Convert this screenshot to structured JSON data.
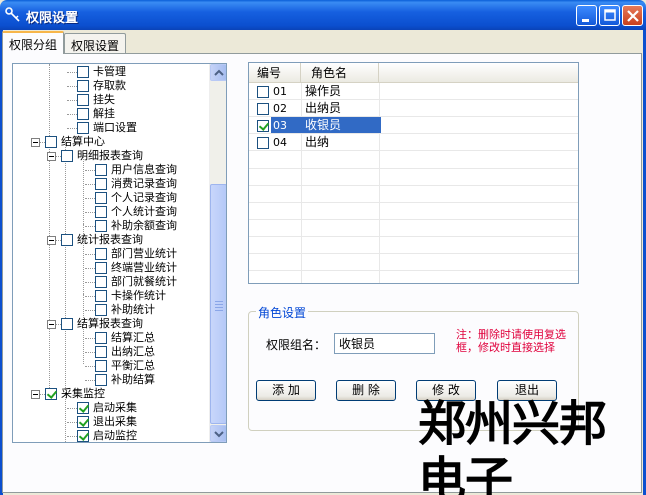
{
  "window": {
    "title": "权限设置",
    "icon": "key-icon"
  },
  "tabs": [
    {
      "label": "权限分组",
      "active": true
    },
    {
      "label": "权限设置",
      "active": false
    }
  ],
  "tree": {
    "items": [
      {
        "label": "卡管理",
        "level": 3,
        "checked": false,
        "expander": false
      },
      {
        "label": "存取款",
        "level": 3,
        "checked": false,
        "expander": false
      },
      {
        "label": "挂失",
        "level": 3,
        "checked": false,
        "expander": false
      },
      {
        "label": "解挂",
        "level": 3,
        "checked": false,
        "expander": false
      },
      {
        "label": "端口设置",
        "level": 3,
        "checked": false,
        "expander": false
      },
      {
        "label": "结算中心",
        "level": 1,
        "checked": false,
        "expander": true
      },
      {
        "label": "明细报表查询",
        "level": 2,
        "checked": false,
        "expander": true
      },
      {
        "label": "用户信息查询",
        "level": 4,
        "checked": false,
        "expander": false
      },
      {
        "label": "消费记录查询",
        "level": 4,
        "checked": false,
        "expander": false
      },
      {
        "label": "个人记录查询",
        "level": 4,
        "checked": false,
        "expander": false
      },
      {
        "label": "个人统计查询",
        "level": 4,
        "checked": false,
        "expander": false
      },
      {
        "label": "补助余额查询",
        "level": 4,
        "checked": false,
        "expander": false
      },
      {
        "label": "统计报表查询",
        "level": 2,
        "checked": false,
        "expander": true
      },
      {
        "label": "部门营业统计",
        "level": 4,
        "checked": false,
        "expander": false
      },
      {
        "label": "终端营业统计",
        "level": 4,
        "checked": false,
        "expander": false
      },
      {
        "label": "部门就餐统计",
        "level": 4,
        "checked": false,
        "expander": false
      },
      {
        "label": "卡操作统计",
        "level": 4,
        "checked": false,
        "expander": false
      },
      {
        "label": "补助统计",
        "level": 4,
        "checked": false,
        "expander": false
      },
      {
        "label": "结算报表查询",
        "level": 2,
        "checked": false,
        "expander": true
      },
      {
        "label": "结算汇总",
        "level": 4,
        "checked": false,
        "expander": false
      },
      {
        "label": "出纳汇总",
        "level": 4,
        "checked": false,
        "expander": false
      },
      {
        "label": "平衡汇总",
        "level": 4,
        "checked": false,
        "expander": false
      },
      {
        "label": "补助结算",
        "level": 4,
        "checked": false,
        "expander": false
      },
      {
        "label": "采集监控",
        "level": 1,
        "checked": true,
        "expander": true
      },
      {
        "label": "启动采集",
        "level": 3,
        "checked": true,
        "expander": false
      },
      {
        "label": "退出采集",
        "level": 3,
        "checked": true,
        "expander": false
      },
      {
        "label": "启动监控",
        "level": 3,
        "checked": true,
        "expander": false
      }
    ]
  },
  "roles": {
    "columns": [
      "编号",
      "角色名"
    ],
    "rows": [
      {
        "id": "01",
        "name": "操作员",
        "checked": false,
        "selected": false
      },
      {
        "id": "02",
        "name": "出纳员",
        "checked": false,
        "selected": false
      },
      {
        "id": "03",
        "name": "收银员",
        "checked": true,
        "selected": true
      },
      {
        "id": "04",
        "name": "出纳",
        "checked": false,
        "selected": false
      }
    ]
  },
  "role_settings": {
    "group_title": "角色设置",
    "field_label": "权限组名：",
    "field_value": "收银员",
    "note": "注：删除时请使用复选框，修改时直接选择",
    "note_color": "#e0003c",
    "buttons": {
      "add": "添 加",
      "delete": "删 除",
      "modify": "修 改",
      "exit": "退出"
    }
  },
  "watermark": "郑州兴邦电子"
}
